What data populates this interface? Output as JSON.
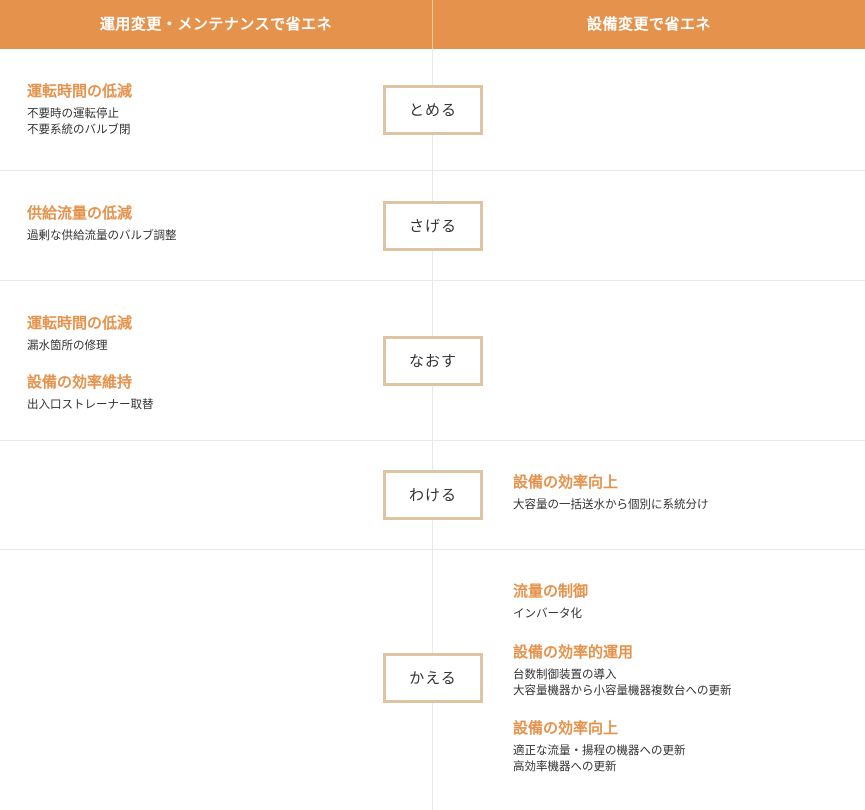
{
  "header": {
    "left_title": "運用変更・メンテナンスで省エネ",
    "right_title": "設備変更で省エネ"
  },
  "colors": {
    "accent": "#e5924c",
    "box_border": "#dfc4a4",
    "line": "#e6e9ef"
  },
  "rows": [
    {
      "action": "とめる",
      "left": [
        {
          "title": "運転時間の低減",
          "lines": [
            "不要時の運転停止",
            "不要系統のバルブ閉"
          ]
        }
      ],
      "right": []
    },
    {
      "action": "さげる",
      "left": [
        {
          "title": "供給流量の低減",
          "lines": [
            "過剰な供給流量のバルブ調整"
          ]
        }
      ],
      "right": []
    },
    {
      "action": "なおす",
      "left": [
        {
          "title": "運転時間の低減",
          "lines": [
            "漏水箇所の修理"
          ]
        },
        {
          "title": "設備の効率維持",
          "lines": [
            "出入口ストレーナー取替"
          ]
        }
      ],
      "right": []
    },
    {
      "action": "わける",
      "left": [],
      "right": [
        {
          "title": "設備の効率向上",
          "lines": [
            "大容量の一括送水から個別に系統分け"
          ]
        }
      ]
    },
    {
      "action": "かえる",
      "left": [],
      "right": [
        {
          "title": "流量の制御",
          "lines": [
            "インバータ化"
          ]
        },
        {
          "title": "設備の効率的運用",
          "lines": [
            "台数制御装置の導入",
            "大容量機器から小容量機器複数台への更新"
          ]
        },
        {
          "title": "設備の効率向上",
          "lines": [
            "適正な流量・揚程の機器への更新",
            "高効率機器への更新"
          ]
        }
      ]
    }
  ]
}
